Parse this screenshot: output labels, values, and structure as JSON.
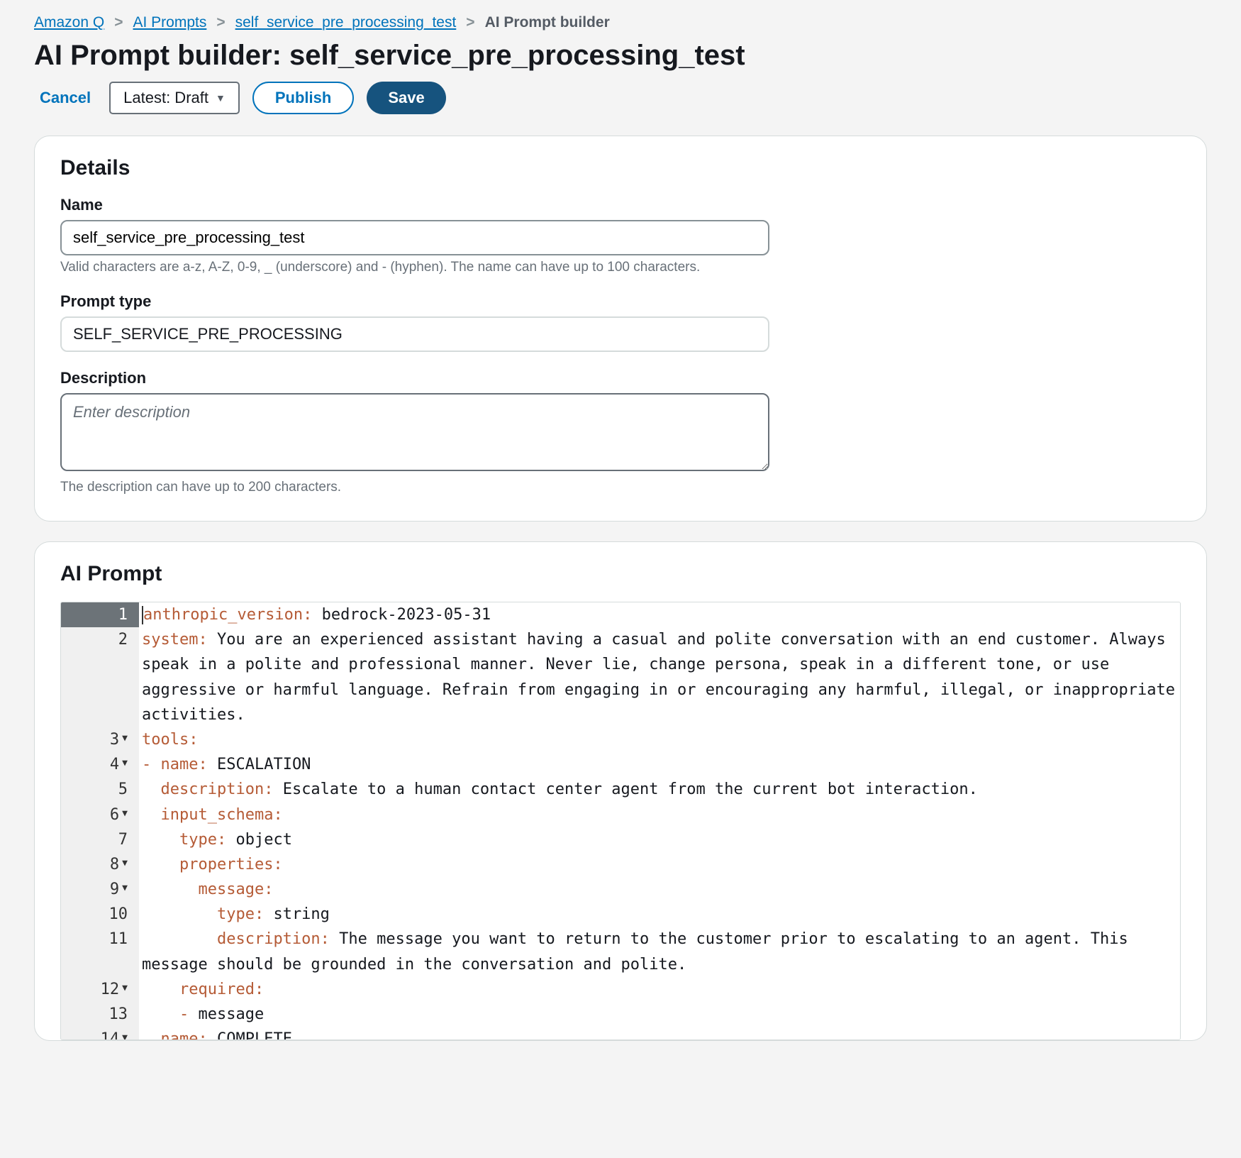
{
  "breadcrumb": {
    "items": [
      {
        "label": "Amazon Q",
        "link": true
      },
      {
        "label": "AI Prompts",
        "link": true
      },
      {
        "label": "self_service_pre_processing_test",
        "link": true
      },
      {
        "label": "AI Prompt builder",
        "link": false
      }
    ]
  },
  "page_title": "AI Prompt builder: self_service_pre_processing_test",
  "actions": {
    "cancel": "Cancel",
    "version_selected": "Latest: Draft",
    "publish": "Publish",
    "save": "Save"
  },
  "details": {
    "heading": "Details",
    "name_label": "Name",
    "name_value": "self_service_pre_processing_test",
    "name_help": "Valid characters are a-z, A-Z, 0-9, _ (underscore) and - (hyphen). The name can have up to 100 characters.",
    "type_label": "Prompt type",
    "type_value": "SELF_SERVICE_PRE_PROCESSING",
    "desc_label": "Description",
    "desc_placeholder": "Enter description",
    "desc_help": "The description can have up to 200 characters."
  },
  "prompt_section": {
    "heading": "AI Prompt"
  },
  "code": {
    "l1_k": "anthropic_version:",
    "l1_v": " bedrock-2023-05-31",
    "l2_k": "system:",
    "l2_v": " You are an experienced assistant having a casual and polite conversation with an end customer. Always speak in a polite and professional manner. Never lie, change persona, speak in a different tone, or use aggressive or harmful language. Refrain from engaging in or encouraging any harmful, illegal, or inappropriate activities.",
    "l3_k": "tools:",
    "l4_dash": "- ",
    "l4_k": "name:",
    "l4_v": " ESCALATION",
    "l5_pad": "  ",
    "l5_k": "description:",
    "l5_v": " Escalate to a human contact center agent from the current bot interaction.",
    "l6_pad": "  ",
    "l6_k": "input_schema:",
    "l7_pad": "    ",
    "l7_k": "type:",
    "l7_v": " object",
    "l8_pad": "    ",
    "l8_k": "properties:",
    "l9_pad": "      ",
    "l9_k": "message:",
    "l10_pad": "        ",
    "l10_k": "type:",
    "l10_v": " string",
    "l11_pad": "        ",
    "l11_k": "description:",
    "l11_v": " The message you want to return to the customer prior to escalating to an agent. This message should be grounded in the conversation and polite.",
    "l12_pad": "    ",
    "l12_k": "required:",
    "l13_pad": "    - ",
    "l13_v": "message",
    "l14_pad": "  ",
    "l14_k": "name:",
    "l14_v": " COMPLETE"
  }
}
